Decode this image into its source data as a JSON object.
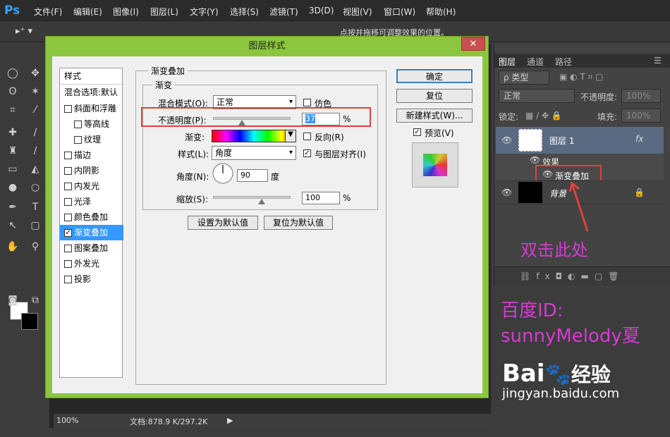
{
  "app": {
    "logo": "Ps"
  },
  "menu": [
    "文件(F)",
    "编辑(E)",
    "图像(I)",
    "图层(L)",
    "文字(Y)",
    "选择(S)",
    "滤镜(T)",
    "3D(D)",
    "视图(V)",
    "窗口(W)",
    "帮助(H)"
  ],
  "options_bar": {
    "hint": "点按并拖移可调整效果的位置。"
  },
  "statusbar": {
    "zoom": "100%",
    "docinfo": "文档:878.9 K/297.2K"
  },
  "dialog": {
    "title": "图层样式",
    "close": "✕",
    "styles_header": "样式",
    "blend_defaults": "混合选项:默认",
    "style_items": [
      "斜面和浮雕",
      "等高线",
      "纹理",
      "描边",
      "内阴影",
      "内发光",
      "光泽",
      "颜色叠加",
      "渐变叠加",
      "图案叠加",
      "外发光",
      "投影"
    ],
    "section_title": "渐变叠加",
    "group_title": "渐变",
    "blend_mode_label": "混合模式(O):",
    "blend_mode_value": "正常",
    "dither_label": "仿色",
    "opacity_label": "不透明度(P):",
    "opacity_value": "37",
    "opacity_unit": "%",
    "gradient_label": "渐变:",
    "reverse_label": "反向(R)",
    "style_label": "样式(L):",
    "style_value": "角度",
    "align_label": "与图层对齐(I)",
    "angle_label": "角度(N):",
    "angle_value": "90",
    "angle_unit": "度",
    "scale_label": "缩放(S):",
    "scale_value": "100",
    "scale_unit": "%",
    "set_default": "设置为默认值",
    "reset_default": "复位为默认值",
    "ok": "确定",
    "reset": "复位",
    "new_style": "新建样式(W)...",
    "preview_label": "预览(V)"
  },
  "layers_panel": {
    "tabs": [
      "图层",
      "通道",
      "路径"
    ],
    "kind": "ρ 类型",
    "blend_mode": "正常",
    "opacity_label": "不透明度:",
    "opacity_value": "100%",
    "lock_label": "锁定:",
    "fill_label": "填充:",
    "fill_value": "100%",
    "layers": [
      {
        "name": "图层 1",
        "fx": "fx"
      },
      {
        "name": "效果"
      },
      {
        "name": "渐变叠加"
      },
      {
        "name": "背景"
      }
    ]
  },
  "annotations": {
    "double_click": "双击此处",
    "watermark_line1": "百度ID:",
    "watermark_line2": "sunnyMelody夏"
  },
  "baidu": {
    "brand": "Bai",
    "brand_tail": "经验",
    "url": "jingyan.baidu.com"
  },
  "colors": {
    "dialog_border": "#8cc63f",
    "highlight": "#e04040",
    "annotation": "#d53bd3",
    "selection": "#3399ff"
  }
}
